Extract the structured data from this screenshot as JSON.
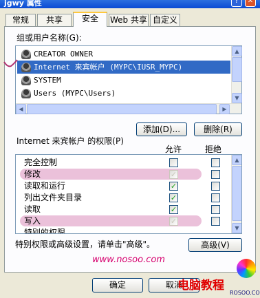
{
  "window": {
    "title": "jgwy 属性",
    "help_glyph": "?",
    "close_glyph": "✕"
  },
  "tabs": [
    {
      "label": "常规"
    },
    {
      "label": "共享"
    },
    {
      "label": "安全"
    },
    {
      "label": "Web 共享"
    },
    {
      "label": "自定义"
    }
  ],
  "users_section": {
    "label": "组或用户名称(G):",
    "items": [
      {
        "name": "CREATOR OWNER",
        "selected": false
      },
      {
        "name": "Internet 来宾帐户 (MYPC\\IUSR_MYPC)",
        "selected": true
      },
      {
        "name": "SYSTEM",
        "selected": false
      },
      {
        "name": "Users (MYPC\\Users)",
        "selected": false
      }
    ],
    "add_button": "添加(D)...",
    "remove_button": "删除(R)"
  },
  "permissions": {
    "label": "Internet 来宾帐户 的权限(P)",
    "allow_header": "允许",
    "deny_header": "拒绝",
    "rows": [
      {
        "name": "完全控制",
        "allow": false,
        "deny": false,
        "highlight": false
      },
      {
        "name": "修改",
        "allow": true,
        "deny": false,
        "highlight": true
      },
      {
        "name": "读取和运行",
        "allow": true,
        "deny": false,
        "highlight": false
      },
      {
        "name": "列出文件夹目录",
        "allow": true,
        "deny": false,
        "highlight": false
      },
      {
        "name": "读取",
        "allow": true,
        "deny": false,
        "highlight": false
      },
      {
        "name": "写入",
        "allow": true,
        "deny": false,
        "highlight": true
      },
      {
        "name": "特别的权限",
        "allow": false,
        "deny": false,
        "highlight": false
      }
    ]
  },
  "advanced": {
    "hint": "特别权限或高级设置，请单击\"高级\"。",
    "button": "高级(V)"
  },
  "footer": {
    "ok_button": "确定",
    "cancel_button": "取消",
    "watermark": "www.nosoo.com",
    "logo_text": "电脑教程",
    "logo_sub": "ROSOO.COM"
  },
  "colors": {
    "selection": "#316ac5",
    "highlight": "#e7b6d4",
    "check": "#21a121",
    "watermark": "#d6006e"
  }
}
